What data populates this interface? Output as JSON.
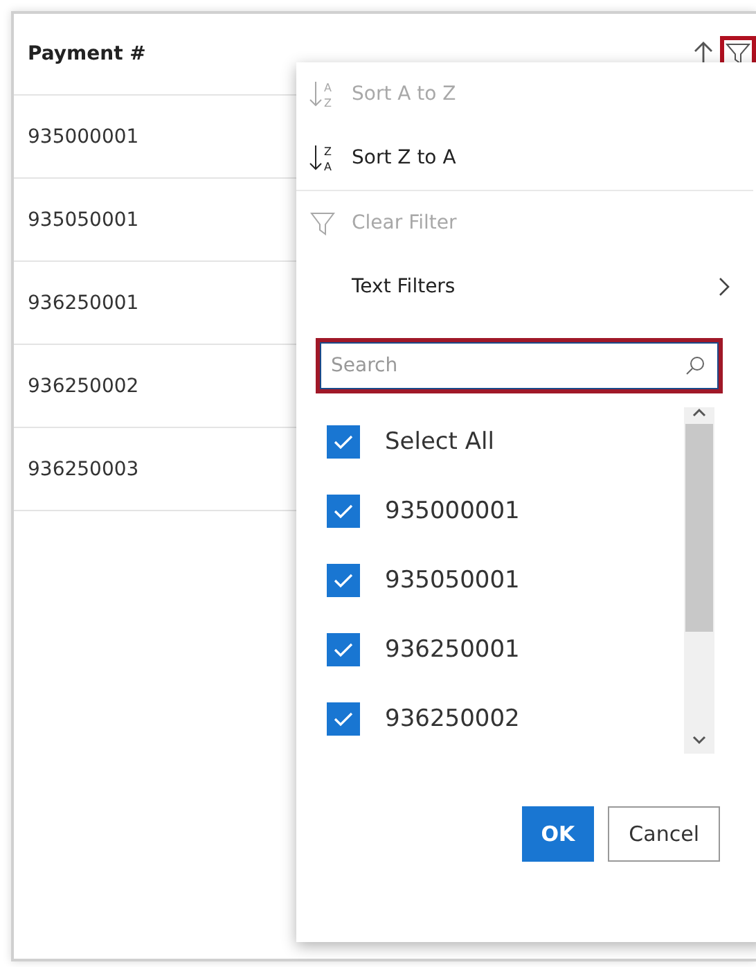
{
  "table": {
    "column": {
      "title": "Payment #",
      "filter_highlighted": true
    },
    "rows": [
      "935000001",
      "935050001",
      "936250001",
      "936250002",
      "936250003"
    ]
  },
  "filter_menu": {
    "commands": [
      {
        "kind": "sort_asc",
        "label": "Sort A to Z",
        "disabled": true,
        "icon_letters": [
          "A",
          "Z"
        ]
      },
      {
        "kind": "sort_desc",
        "label": "Sort Z to A",
        "disabled": false,
        "icon_letters": [
          "Z",
          "A"
        ]
      },
      {
        "kind": "clear",
        "label": "Clear Filter",
        "disabled": true
      },
      {
        "kind": "submenu",
        "label": "Text Filters",
        "disabled": false
      }
    ],
    "search": {
      "placeholder": "Search",
      "highlighted": true
    },
    "options": [
      {
        "label": "Select All",
        "checked": true
      },
      {
        "label": "935000001",
        "checked": true
      },
      {
        "label": "935050001",
        "checked": true
      },
      {
        "label": "936250001",
        "checked": true
      },
      {
        "label": "936250002",
        "checked": true
      }
    ],
    "buttons": [
      {
        "kind": "primary",
        "label": "OK"
      },
      {
        "kind": "secondary",
        "label": "Cancel"
      }
    ]
  }
}
